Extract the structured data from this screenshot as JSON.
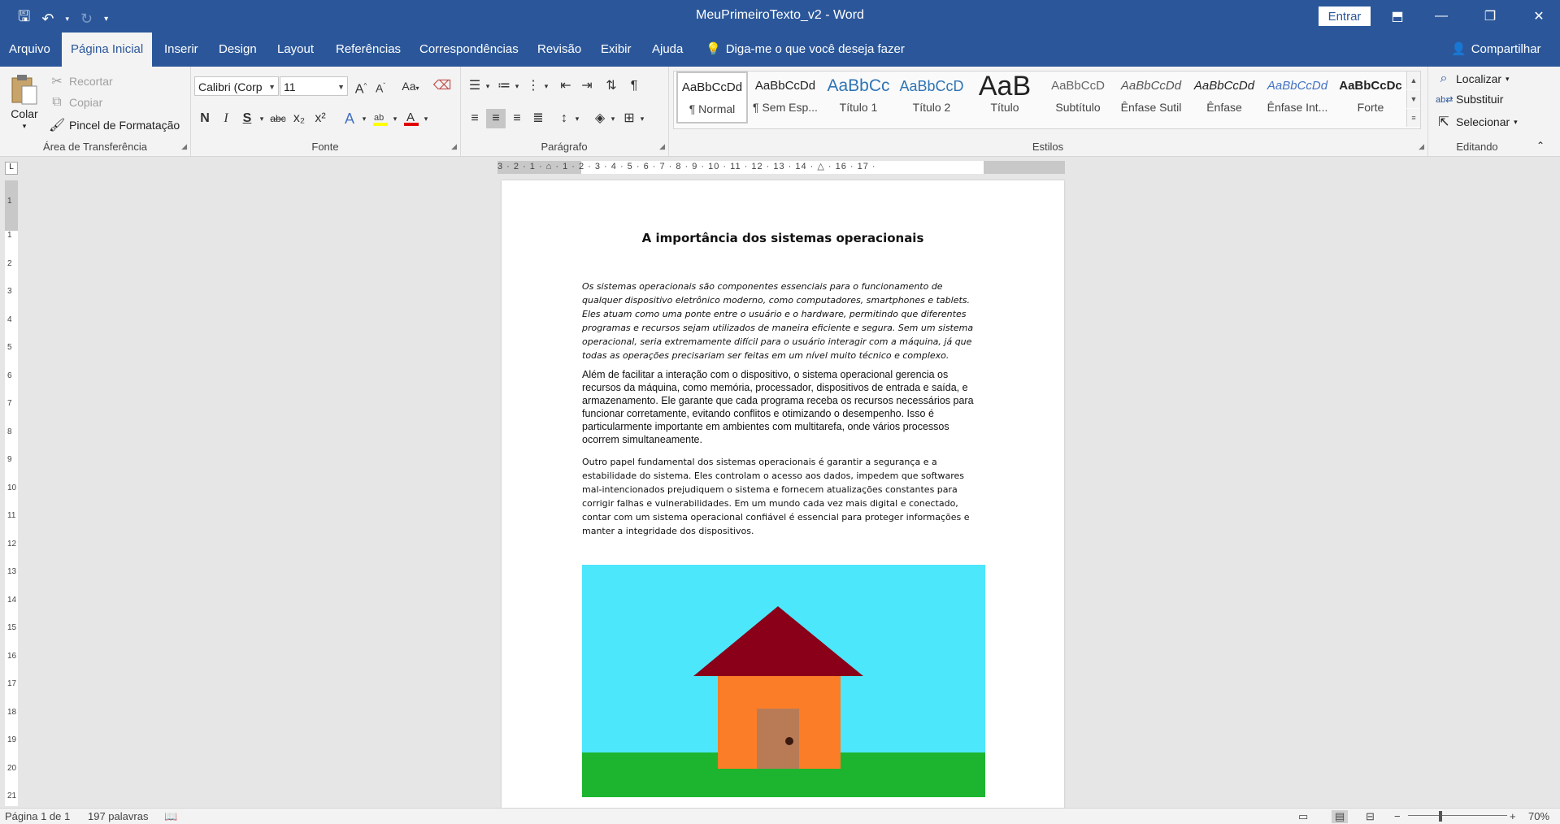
{
  "window": {
    "title": "MeuPrimeiroTexto_v2  -  Word",
    "signin_label": "Entrar"
  },
  "tabs": [
    "Arquivo",
    "Página Inicial",
    "Inserir",
    "Design",
    "Layout",
    "Referências",
    "Correspondências",
    "Revisão",
    "Exibir",
    "Ajuda"
  ],
  "active_tab": "Página Inicial",
  "tell_me": "Diga-me o que você deseja fazer",
  "share_label": "Compartilhar",
  "ribbon": {
    "clipboard": {
      "paste": "Colar",
      "cut": "Recortar",
      "copy": "Copiar",
      "format_painter": "Pincel de Formatação",
      "label": "Área de Transferência"
    },
    "font": {
      "family": "Calibri (Corp",
      "size": "11",
      "label": "Fonte",
      "change_case": "Aa",
      "bold": "N",
      "italic": "I",
      "underline": "S",
      "strike": "abc",
      "subscript": "x₂",
      "superscript": "x²",
      "grow": "A",
      "shrink": "A"
    },
    "paragraph": {
      "label": "Parágrafo"
    },
    "styles": {
      "label": "Estilos",
      "items": [
        {
          "preview": "AaBbCcDd",
          "name": "¶ Normal"
        },
        {
          "preview": "AaBbCcDd",
          "name": "¶ Sem Esp..."
        },
        {
          "preview": "AaBbCc",
          "name": "Título 1"
        },
        {
          "preview": "AaBbCcD",
          "name": "Título 2"
        },
        {
          "preview": "AaB",
          "name": "Título"
        },
        {
          "preview": "AaBbCcD",
          "name": "Subtítulo"
        },
        {
          "preview": "AaBbCcDd",
          "name": "Ênfase Sutil"
        },
        {
          "preview": "AaBbCcDd",
          "name": "Ênfase"
        },
        {
          "preview": "AaBbCcDd",
          "name": "Ênfase Int..."
        },
        {
          "preview": "AaBbCcDc",
          "name": "Forte"
        }
      ]
    },
    "editing": {
      "label": "Editando",
      "find": "Localizar",
      "replace": "Substituir",
      "select": "Selecionar"
    }
  },
  "ruler": {
    "horizontal": "3 · 2 · 1 · ⌂ · 1 · 2 · 3 · 4 · 5 · 6 · 7 · 8 · 9 · 10 · 11 · 12 · 13 · 14 · △ · 16 · 17 ·",
    "vertical_numbers": [
      "1",
      "1",
      "2",
      "3",
      "4",
      "5",
      "6",
      "7",
      "8",
      "9",
      "10",
      "11",
      "12",
      "13",
      "14",
      "15",
      "16",
      "17",
      "18",
      "19",
      "20",
      "21"
    ]
  },
  "document": {
    "title": "A importância dos sistemas operacionais",
    "paragraphs": [
      "Os sistemas operacionais são componentes essenciais para o funcionamento de qualquer dispositivo eletrônico moderno, como computadores, smartphones e tablets. Eles atuam como uma ponte entre o usuário e o hardware, permitindo que diferentes programas e recursos sejam utilizados de maneira eficiente e segura. Sem um sistema operacional, seria extremamente difícil para o usuário interagir com a máquina, já que todas as operações precisariam ser feitas em um nível muito técnico e complexo.",
      "Além de facilitar a interação com o dispositivo, o sistema operacional gerencia os recursos da máquina, como memória, processador, dispositivos de entrada e saída, e armazenamento. Ele garante que cada programa receba os recursos necessários para funcionar corretamente, evitando conflitos e otimizando o desempenho. Isso é particularmente importante em ambientes com multitarefa, onde vários processos ocorrem simultaneamente.",
      "Outro papel fundamental dos sistemas operacionais é garantir a segurança e a estabilidade do sistema. Eles controlam o acesso aos dados, impedem que softwares mal-intencionados prejudiquem o sistema e fornecem atualizações constantes para corrigir falhas e vulnerabilidades. Em um mundo cada vez mais digital e conectado, contar com um sistema operacional confiável é essencial para proteger informações e manter a integridade dos dispositivos."
    ],
    "drawing_colors": {
      "sky": "#4de7fb",
      "grass": "#1db52f",
      "roof": "#8a0019",
      "wall": "#fb7d28",
      "door": "#b97b56",
      "knob": "#3a1a10"
    }
  },
  "status": {
    "page": "Página 1 de 1",
    "words": "197 palavras",
    "zoom": "70%"
  },
  "colors": {
    "brand": "#2b579a",
    "ribbon_bg": "#f3f3f3",
    "canvas_bg": "#e6e6e6",
    "highlight": "#ffff00",
    "font_color": "#e00000"
  }
}
